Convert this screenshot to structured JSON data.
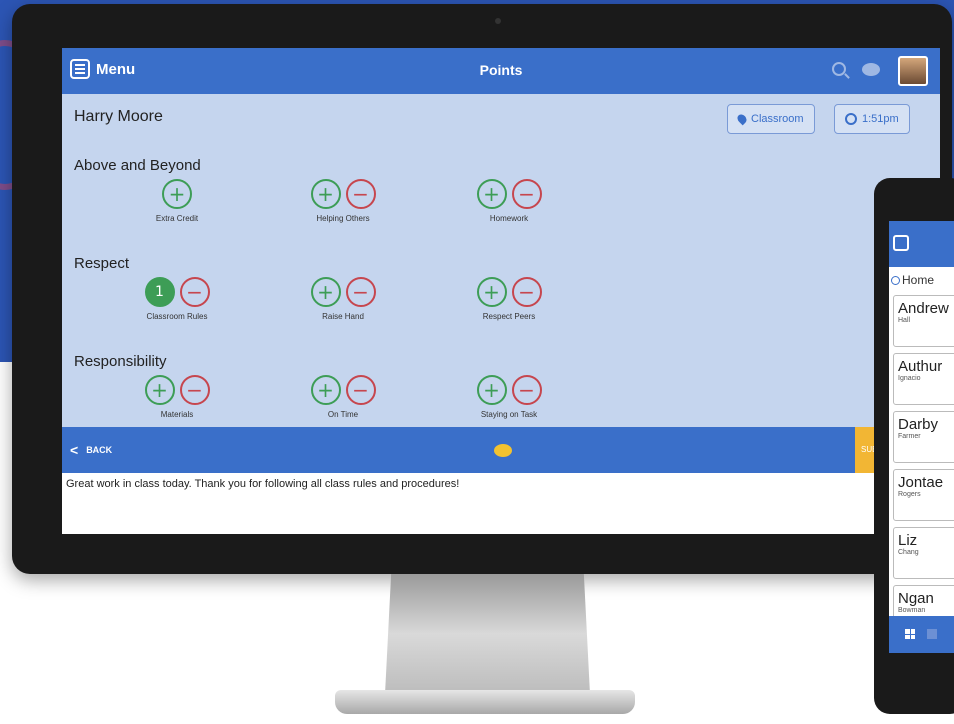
{
  "screen": {
    "menu_label": "Menu",
    "page_title": "Points",
    "student_name": "Harry Moore",
    "location_label": "Classroom",
    "time_label": "1:51pm",
    "categories": [
      {
        "name": "Above and Beyond",
        "behaviors": [
          {
            "label": "Extra Credit",
            "count": null,
            "has_minus": false
          },
          {
            "label": "Helping Others",
            "count": null,
            "has_minus": true
          },
          {
            "label": "Homework",
            "count": null,
            "has_minus": true
          }
        ]
      },
      {
        "name": "Respect",
        "behaviors": [
          {
            "label": "Classroom Rules",
            "count": "1",
            "has_minus": true
          },
          {
            "label": "Raise Hand",
            "count": null,
            "has_minus": true
          },
          {
            "label": "Respect Peers",
            "count": null,
            "has_minus": true
          }
        ]
      },
      {
        "name": "Responsibility",
        "behaviors": [
          {
            "label": "Materials",
            "count": null,
            "has_minus": true
          },
          {
            "label": "On Time",
            "count": null,
            "has_minus": true
          },
          {
            "label": "Staying on Task",
            "count": null,
            "has_minus": true
          }
        ]
      }
    ],
    "back_label": "BACK",
    "submit_label": "SUB",
    "comment_text": "Great work in class today. Thank you for following all class rules and procedures!",
    "colors": {
      "primary": "#3a6fc9",
      "background": "#c5d5ee",
      "positive": "#3d9d56",
      "negative": "#c6464e",
      "submit": "#f2b634"
    },
    "icons": [
      "menu-icon",
      "search-icon",
      "chat-icon",
      "location-pin-icon",
      "clock-icon",
      "plus-icon",
      "minus-icon",
      "back-chevron-icon",
      "comment-icon"
    ]
  },
  "tablet": {
    "home_label": "Home",
    "students": [
      {
        "first": "Andrew",
        "last": "Hall"
      },
      {
        "first": "Authur",
        "last": "Ignacio"
      },
      {
        "first": "Darby",
        "last": "Farmer"
      },
      {
        "first": "Jontae",
        "last": "Rogers"
      },
      {
        "first": "Liz",
        "last": "Chang"
      },
      {
        "first": "Ngan",
        "last": "Bowman"
      }
    ]
  }
}
